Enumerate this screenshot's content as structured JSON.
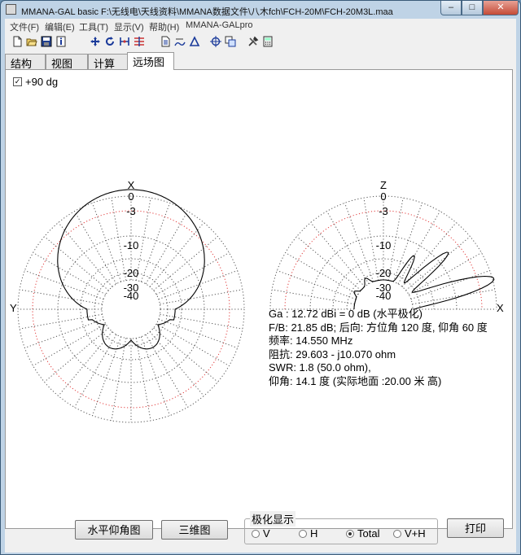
{
  "window": {
    "title": "MMANA-GAL basic F:\\无线电\\天线资料\\MMANA数据文件\\八木fch\\FCH-20M\\FCH-20M3L.maa",
    "min_glyph": "–",
    "max_glyph": "□",
    "close_glyph": "✕"
  },
  "menu": [
    "文件(F)",
    "编辑(E)",
    "工具(T)",
    "显示(V)",
    "帮助(H)",
    "MMANA-GALpro"
  ],
  "toolbar_icons": [
    "new-file-icon",
    "open-folder-icon",
    "save-icon",
    "info-icon",
    "move-arrows-icon",
    "rotate-icon",
    "wire-icon",
    "wire-list-icon",
    "document-icon",
    "edit-icon",
    "triangle-icon",
    "target-icon",
    "copy-icon",
    "tools-icon",
    "calculator-icon"
  ],
  "tabs": [
    "结构",
    "视图",
    "计算",
    "远场图"
  ],
  "active_tab": 3,
  "elevation_checkbox": {
    "label": "+90 dg",
    "checked": true
  },
  "horizontal_plot": {
    "axis_top": "X",
    "axis_left": "Y",
    "ring_labels": [
      "0",
      "-3",
      "-10",
      "-20",
      "-30",
      "-40"
    ]
  },
  "vertical_plot": {
    "axis_top": "Z",
    "axis_right": "X",
    "ring_labels": [
      "0",
      "-3",
      "-10",
      "-20",
      "-30",
      "-40"
    ]
  },
  "colors": {
    "pattern": "#000000",
    "grid": "#555555",
    "minus3_ring": "#e23b3b"
  },
  "info_lines": [
    "Ga : 12.72 dBi = 0 dB  (水平极化)",
    "F/B: 21.85 dB; 后向: 方位角 120 度,  仰角 60 度",
    "频率: 14.550 MHz",
    "阻抗: 29.603 - j10.070 ohm",
    "SWR: 1.8 (50.0 ohm),",
    "仰角: 14.1 度 (实际地面  :20.00 米 高)"
  ],
  "buttons": {
    "elevation_plot": "水平仰角图",
    "view_3d": "三维图",
    "print": "打印"
  },
  "polarization": {
    "title": "极化显示",
    "options": [
      "V",
      "H",
      "Total",
      "V+H"
    ],
    "selected": "Total"
  }
}
